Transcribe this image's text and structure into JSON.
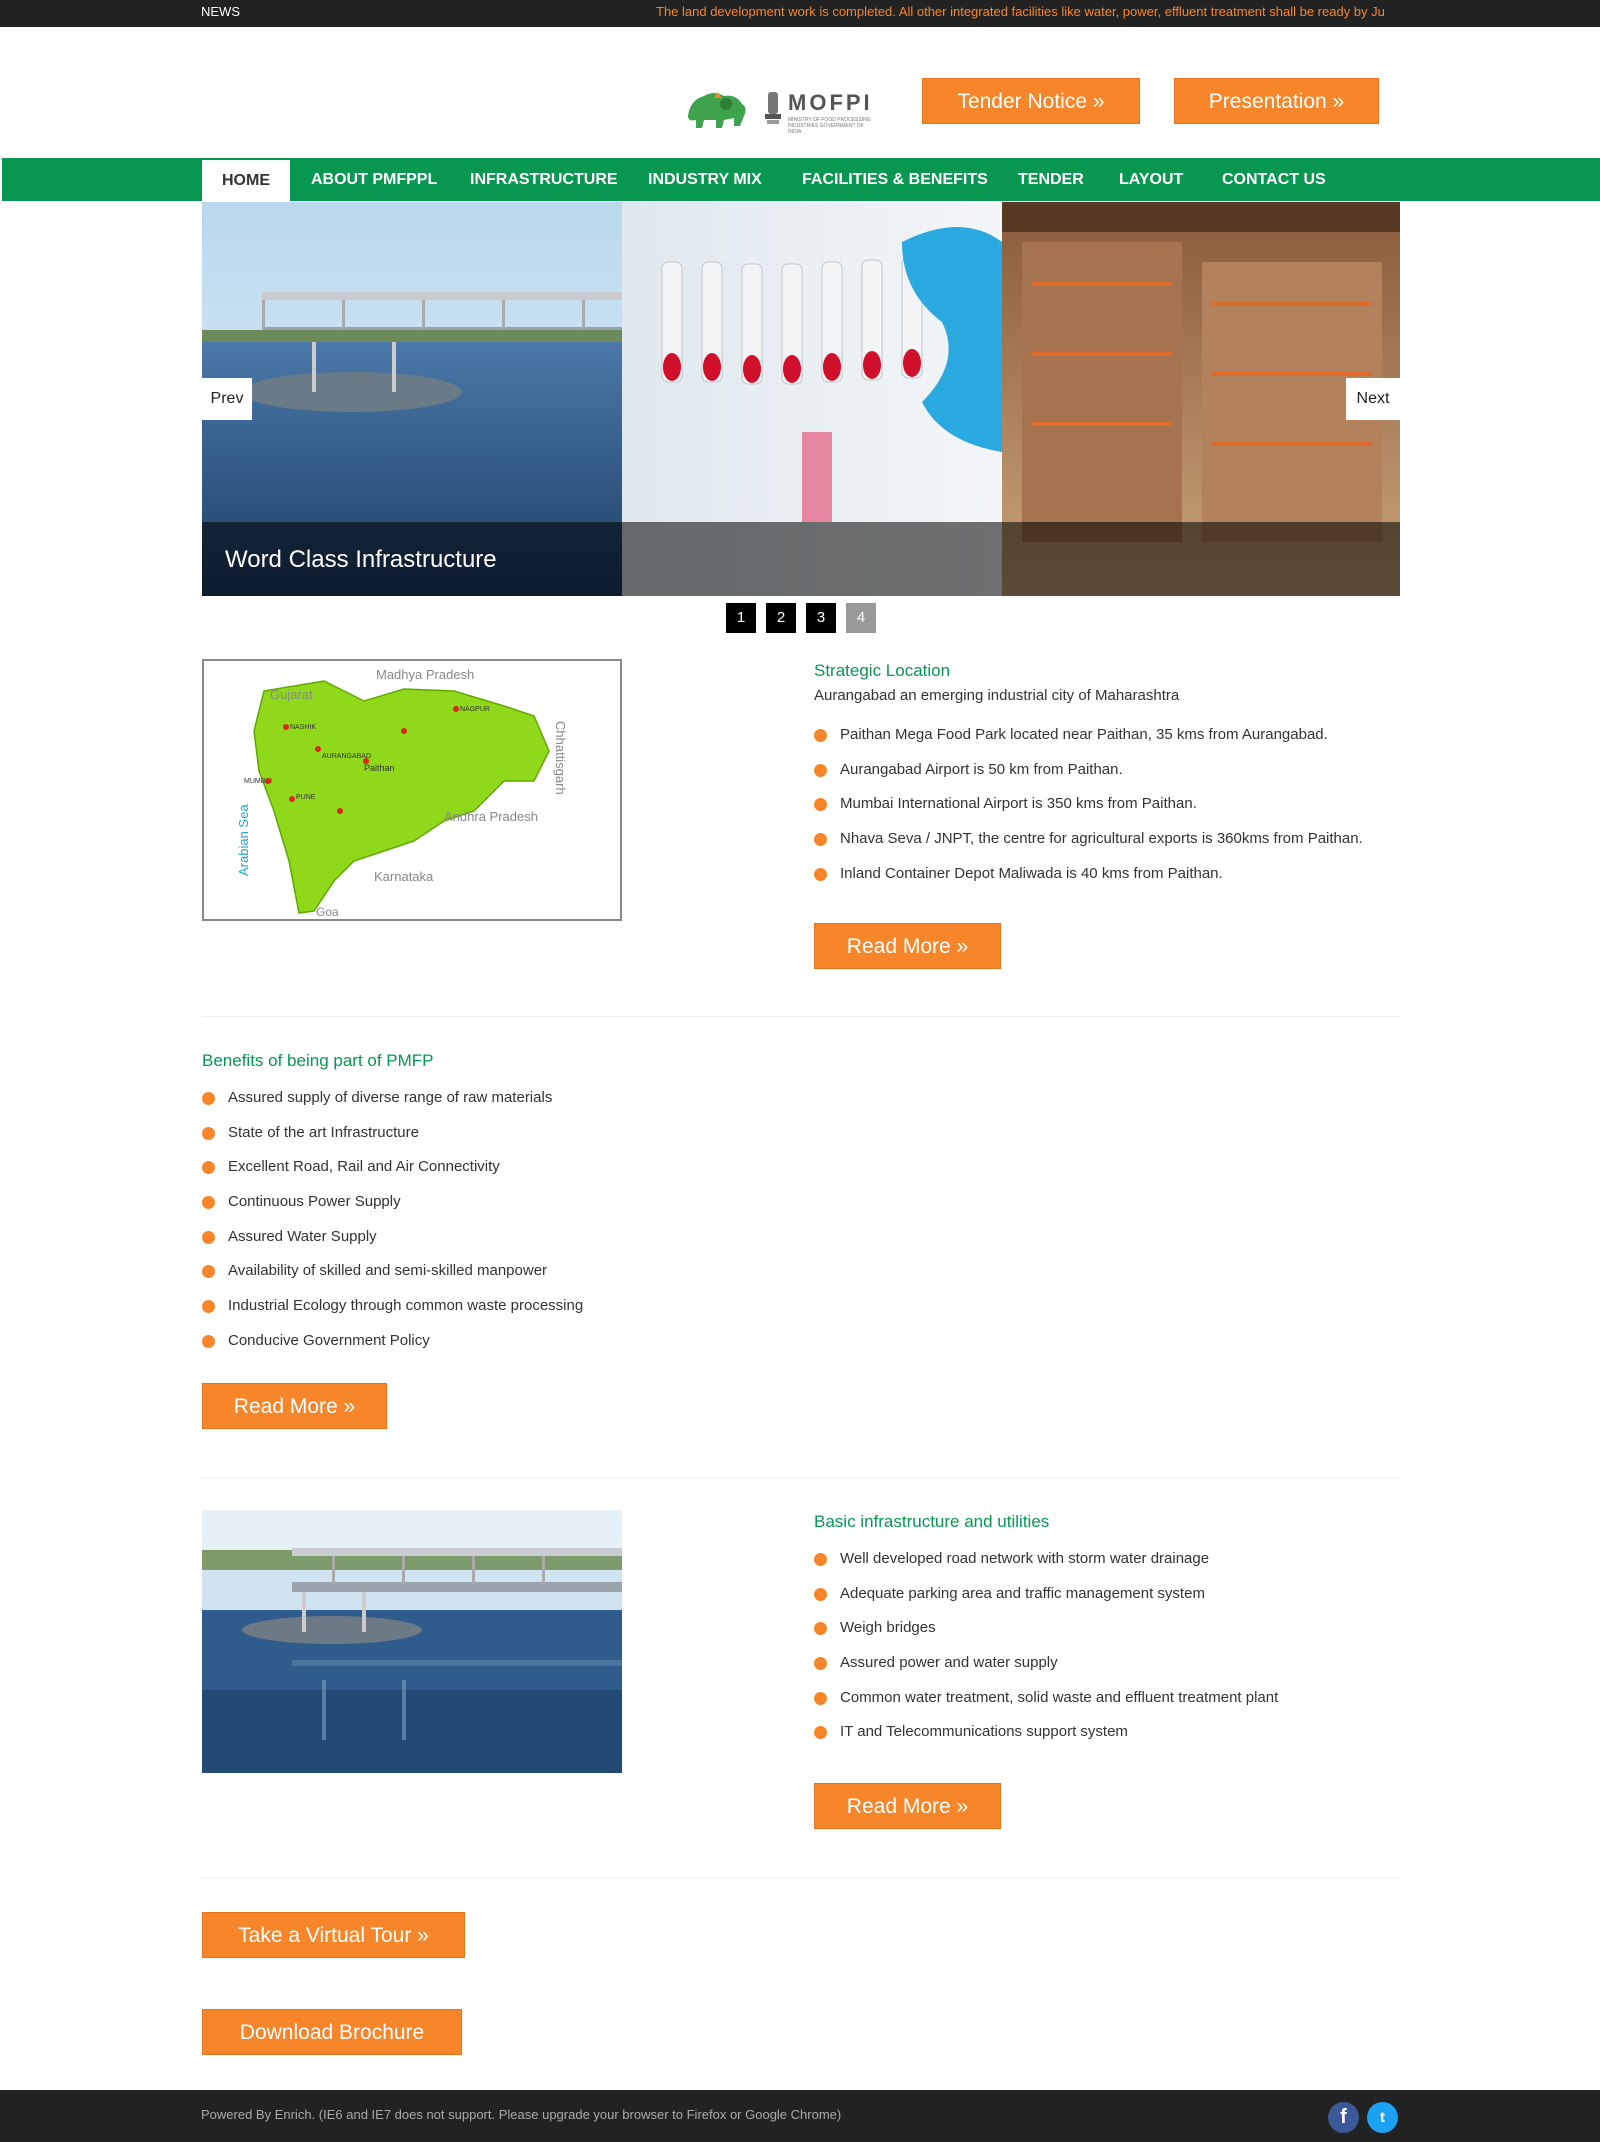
{
  "news": {
    "label": "NEWS",
    "ticker": "The land development work is completed. All other integrated facilities like water, power, effluent treatment shall be ready by Ju"
  },
  "header": {
    "logo_text": "MOFPI",
    "logo_subtext": "MINISTRY OF FOOD PROCESSING INDUSTRIES GOVERNMENT OF INDIA",
    "tender_button": "Tender Notice »",
    "presentation_button": "Presentation »"
  },
  "nav": {
    "items": [
      {
        "label": "HOME"
      },
      {
        "label": "ABOUT PMFPPL"
      },
      {
        "label": "INFRASTRUCTURE"
      },
      {
        "label": "INDUSTRY MIX"
      },
      {
        "label": "FACILITIES & BENEFITS"
      },
      {
        "label": "TENDER"
      },
      {
        "label": "LAYOUT"
      },
      {
        "label": "CONTACT US"
      }
    ]
  },
  "slider": {
    "caption": "Word Class Infrastructure",
    "prev": "Prev",
    "next": "Next",
    "pages": [
      "1",
      "2",
      "3",
      "4"
    ],
    "current_page": "4"
  },
  "strategic": {
    "title": "Strategic Location",
    "subtitle": "Aurangabad an emerging industrial city of Maharashtra",
    "items": [
      "Paithan Mega Food Park located near Paithan, 35 kms from Aurangabad.",
      "Aurangabad Airport is 50 km from Paithan.",
      "Mumbai International Airport is 350 kms from Paithan.",
      "Nhava Seva / JNPT, the centre for agricultural exports is 360kms from Paithan.",
      "Inland Container Depot Maliwada is 40 kms from Paithan."
    ],
    "button": "Read More »"
  },
  "map": {
    "labels": {
      "madhya_pradesh": "Madhya Pradesh",
      "gujarat": "Gujarat",
      "chhattisgarh": "Chhattisgarh",
      "andhra_pradesh": "Andhra Pradesh",
      "karnataka": "Karnataka",
      "goa": "Goa",
      "arabian_sea": "Arabian Sea",
      "aurangabad": "AURANGABAD",
      "paithan": "Paithan",
      "mumbai": "MUMBAI",
      "nagpur": "NAGPUR",
      "nashik": "NASHIK",
      "pune": "PUNE"
    }
  },
  "benefits": {
    "title": "Benefits of being part of PMFP",
    "items": [
      "Assured supply of diverse range of raw materials",
      "State of the art Infrastructure",
      "Excellent Road, Rail and Air Connectivity",
      "Continuous Power Supply",
      "Assured Water Supply",
      "Availability of skilled and semi-skilled manpower",
      "Industrial Ecology through common waste processing",
      "Conducive Government Policy"
    ],
    "button": "Read More »"
  },
  "basic": {
    "title": "Basic infrastructure and utilities",
    "items": [
      "Well developed road network with storm water drainage",
      "Adequate parking area and traffic management system",
      "Weigh bridges",
      "Assured power and water supply",
      "Common water treatment, solid waste and effluent treatment plant",
      "IT and Telecommunications support system"
    ],
    "button": "Read More »"
  },
  "actions": {
    "virtual_tour": "Take a Virtual Tour »",
    "brochure": "Download Brochure"
  },
  "footer": {
    "text": "Powered By Enrich. (IE6 and IE7 does not support. Please upgrade your browser to Firefox or Google Chrome)",
    "facebook": "f",
    "twitter": "t"
  },
  "colors": {
    "accent_orange": "#f7862a",
    "nav_green": "#079750",
    "dark_bar": "#222222"
  }
}
